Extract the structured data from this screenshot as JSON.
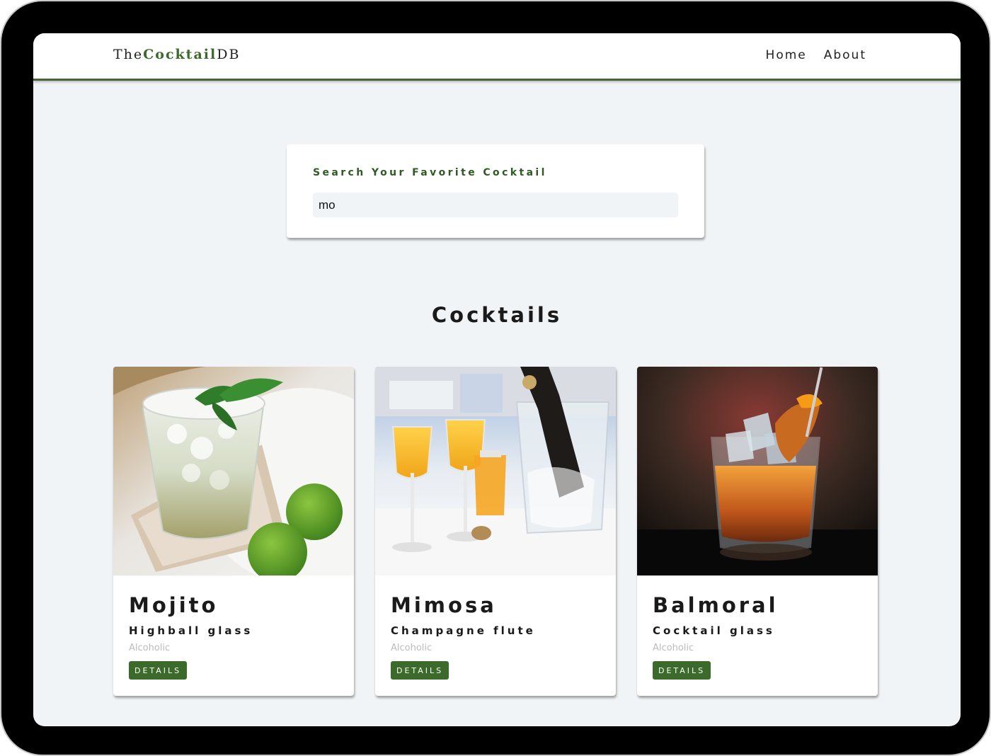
{
  "navbar": {
    "logo_prefix": "The",
    "logo_accent": "Cocktail",
    "logo_suffix": "DB",
    "links": [
      {
        "label": "Home"
      },
      {
        "label": "About"
      }
    ]
  },
  "search": {
    "label": "Search Your Favorite Cocktail",
    "value": "mo"
  },
  "section_title": "Cocktails",
  "cocktails": [
    {
      "name": "Mojito",
      "glass": "Highball glass",
      "info": "Alcoholic",
      "button": "DETAILS"
    },
    {
      "name": "Mimosa",
      "glass": "Champagne flute",
      "info": "Alcoholic",
      "button": "DETAILS"
    },
    {
      "name": "Balmoral",
      "glass": "Cocktail glass",
      "info": "Alcoholic",
      "button": "DETAILS"
    }
  ],
  "colors": {
    "accent": "#3c6a2a",
    "navbar_border": "#4a6339",
    "page_bg": "#f1f4f6"
  }
}
